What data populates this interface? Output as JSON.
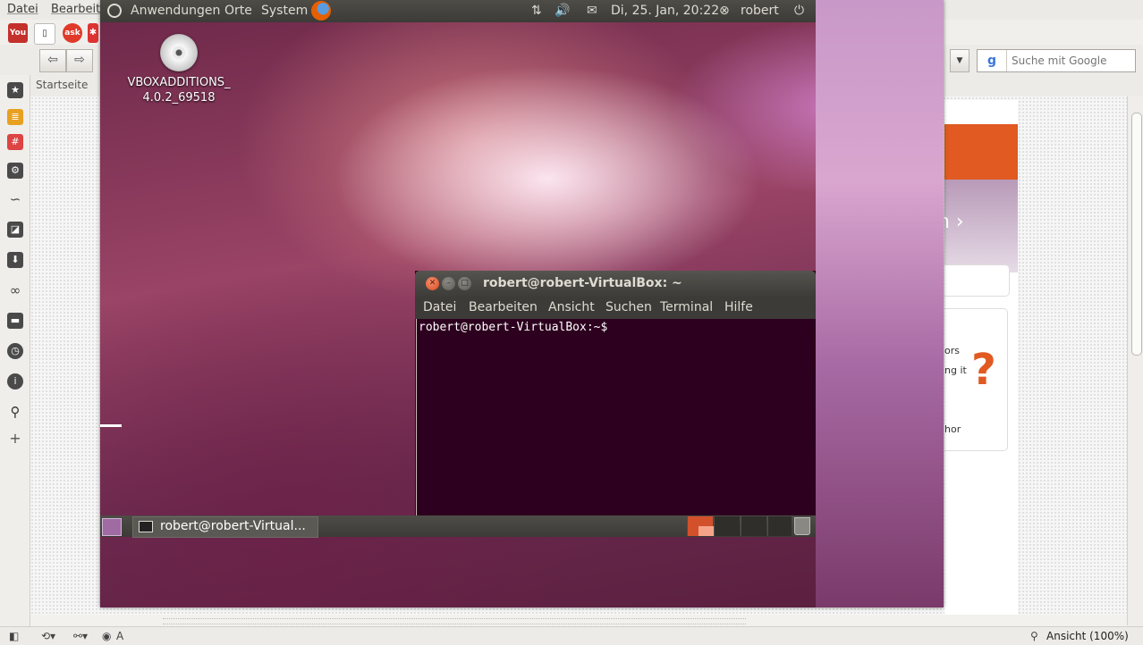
{
  "host": {
    "menu": [
      "Datei",
      "Bearbeit"
    ],
    "search_placeholder": "Suche mit Google",
    "bookmark": "Startseite",
    "status_zoom": "Ansicht (100%)",
    "status_lang": "A",
    "page_snippets": {
      "text1": "n ›",
      "text2": "ors",
      "text3": "ng it",
      "text4": "hor"
    },
    "ext_icons": [
      {
        "name": "youtube",
        "label": "You",
        "color": "#c4302b"
      },
      {
        "name": "ask",
        "label": "ask",
        "color": "#e03a2a"
      }
    ]
  },
  "guest": {
    "panel": {
      "menus": [
        "Anwendungen",
        "Orte",
        "System"
      ],
      "datetime": "Di, 25. Jan, 20:22",
      "user": "robert"
    },
    "desktop_icon": {
      "line1": "VBOXADDITIONS_",
      "line2": "4.0.2_69518"
    },
    "terminal": {
      "title": "robert@robert-VirtualBox: ~",
      "menus": [
        "Datei",
        "Bearbeiten",
        "Ansicht",
        "Suchen",
        "Terminal",
        "Hilfe"
      ],
      "prompt": "robert@robert-VirtualBox:~$"
    },
    "taskbar": {
      "item_label": "robert@robert-Virtual..."
    }
  },
  "colors": {
    "ubuntu_orange": "#e05a22",
    "terminal_bg": "#2c001e",
    "panel_bg": "#3c3b37"
  }
}
